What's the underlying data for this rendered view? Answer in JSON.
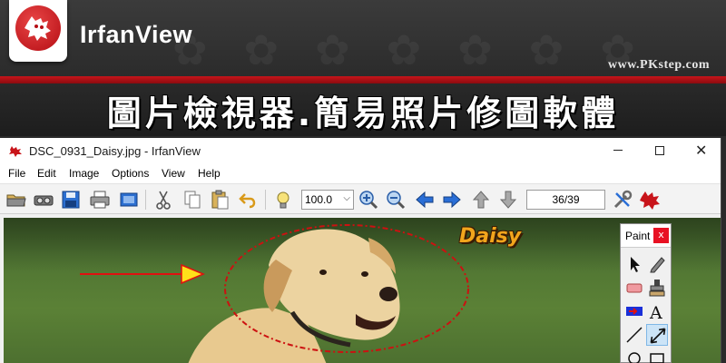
{
  "banner": {
    "app_name": "IrfanView",
    "site_url": "www.PKstep.com",
    "tagline": "圖片檢視器.簡易照片修圖軟體",
    "logo_icon": "irfanview-cat-logo"
  },
  "window": {
    "title": "DSC_0931_Daisy.jpg - IrfanView",
    "controls": {
      "minimize": "minimize",
      "maximize": "maximize",
      "close": "✕"
    }
  },
  "menu": [
    "File",
    "Edit",
    "Image",
    "Options",
    "View",
    "Help"
  ],
  "toolbar": {
    "zoom_value": "100.0",
    "zoom_arrow": "⌵",
    "page_counter": "36/39",
    "icons": [
      "open-folder-icon",
      "slideshow-icon",
      "save-icon",
      "print-icon",
      "scan-icon",
      "cut-icon",
      "copy-icon",
      "paste-icon",
      "undo-icon",
      "info-bulb-icon",
      "zoom-in-icon",
      "zoom-out-icon",
      "previous-icon",
      "next-icon",
      "first-image-icon",
      "last-image-icon",
      "settings-icon",
      "about-icon"
    ]
  },
  "image": {
    "annotation_text": "Daisy",
    "annotation_color": "#f2a51c",
    "arrow_color": "#e01010",
    "ellipse_color": "#cc1111"
  },
  "paint": {
    "title": "Paint",
    "close": "x",
    "tools": [
      "selection-arrow-icon",
      "pen-icon",
      "eraser-icon",
      "clone-stamp-icon",
      "color-replace-icon",
      "text-icon",
      "line-icon",
      "arrow-line-icon",
      "circle-icon",
      "rectangle-icon"
    ],
    "text_tool_glyph": "A"
  }
}
